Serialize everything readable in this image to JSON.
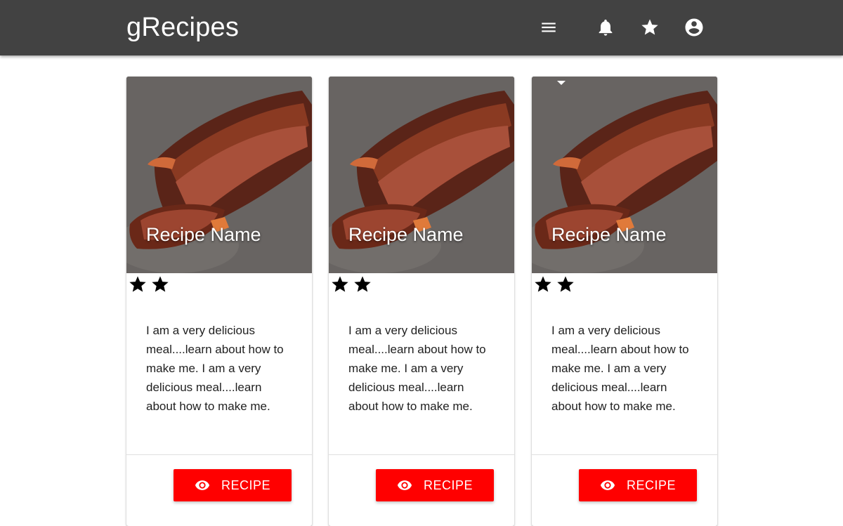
{
  "appbar": {
    "brand": "gRecipes",
    "icons": [
      "menu-icon",
      "bell-icon",
      "star-icon",
      "account-circle-icon"
    ]
  },
  "cards": [
    {
      "title": "Recipe Name",
      "rating": 2,
      "description": "I am a very delicious meal....learn about how to make me. I am a very delicious meal....learn about how to make me.",
      "button_label": "RECIPE"
    },
    {
      "title": "Recipe Name",
      "rating": 2,
      "description": "I am a very delicious meal....learn about how to make me. I am a very delicious meal....learn about how to make me.",
      "button_label": "RECIPE"
    },
    {
      "title": "Recipe Name",
      "rating": 2,
      "description": "I am a very delicious meal....learn about how to make me. I am a very delicious meal....learn about how to make me.",
      "button_label": "RECIPE"
    }
  ],
  "colors": {
    "appbar": "#424242",
    "button": "#ff0000",
    "star": "#000000"
  }
}
